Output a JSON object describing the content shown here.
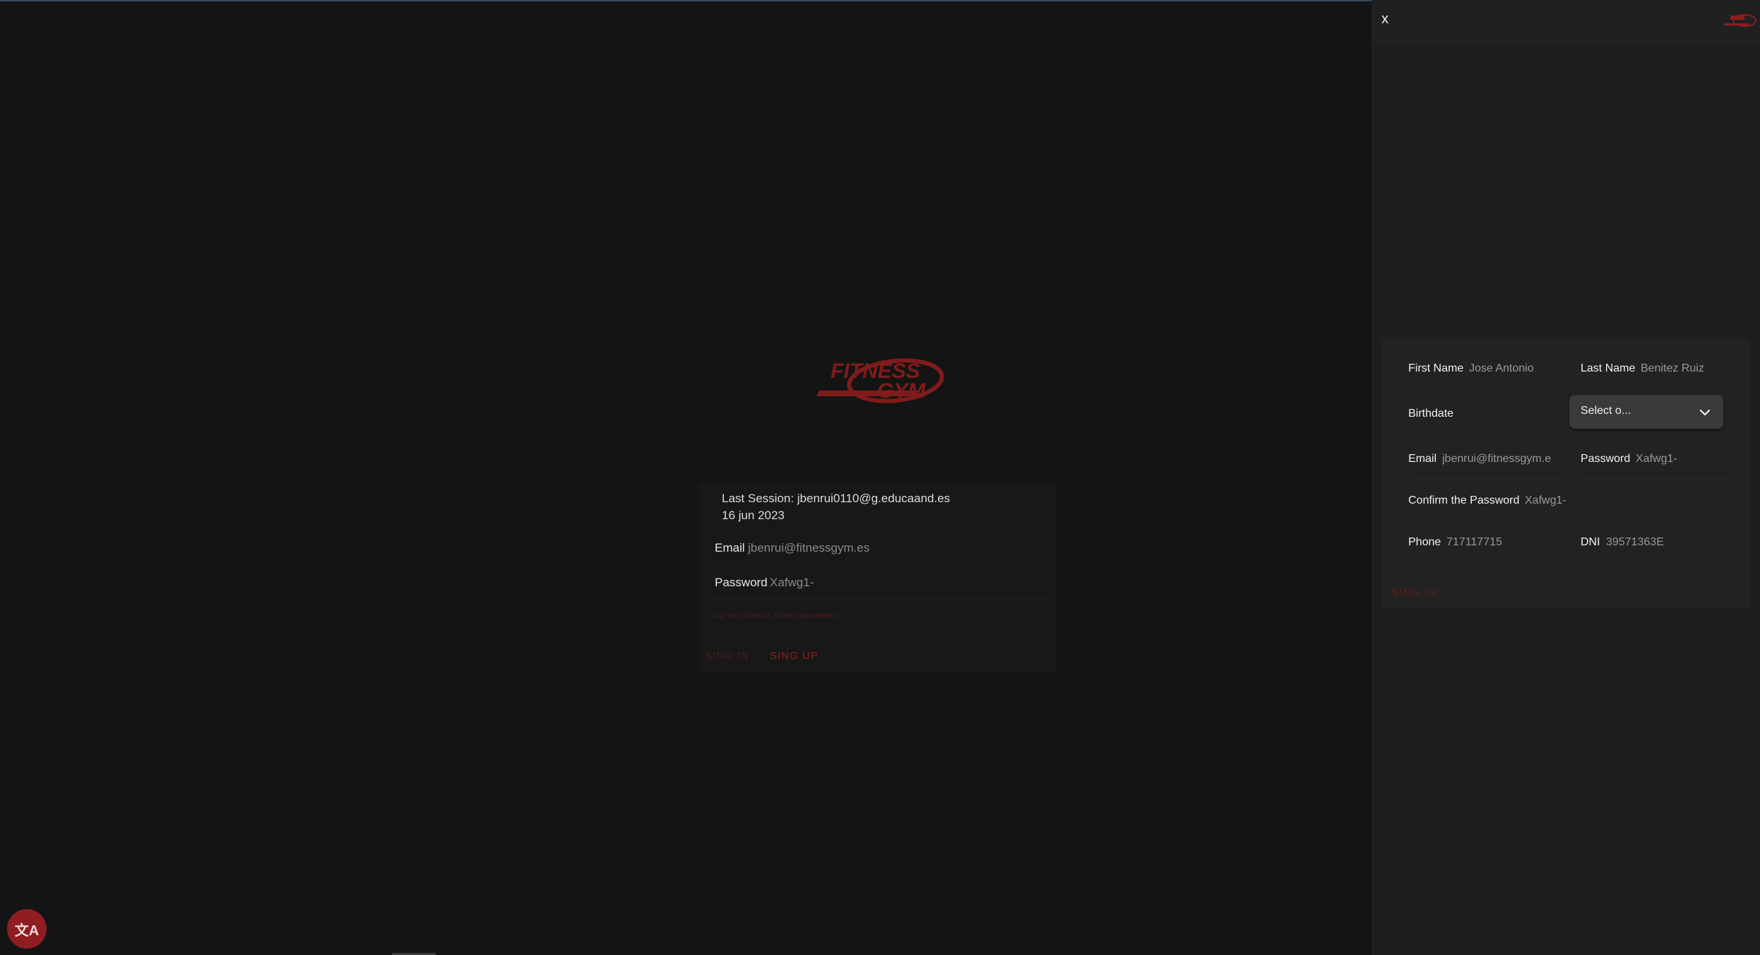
{
  "app": {
    "logo_text": "FITNESS GYM",
    "accent_color": "#8f1d22"
  },
  "login": {
    "last_session_label": "Last Session: jbenrui0110@g.educaand.es",
    "last_session_date": "16 jun 2023",
    "email_label": "Email",
    "email_value": "jbenrui@fitnessgym.es",
    "password_label": "Password",
    "password_value": "Xafwg1-",
    "forgot_label": "DO YOU FORGET YOUR PASSWORD?",
    "signin_label": "SING IN",
    "signup_label": "SING UP"
  },
  "translate_button": {
    "icon": "translate-icon",
    "glyph": "文A"
  },
  "drawer": {
    "close_label": "x",
    "fields": {
      "first_name_label": "First Name",
      "first_name_value": "Jose Antonio",
      "last_name_label": "Last Name",
      "last_name_value": "Benitez Ruiz",
      "birthdate_label": "Birthdate",
      "birthdate_select": "Select o...",
      "email_label": "Email",
      "email_value": "jbenrui@fitnessgym.e",
      "password_label": "Password",
      "password_value": "Xafwg1-",
      "confirm_label": "Confirm the Password",
      "confirm_value": "Xafwg1-",
      "phone_label": "Phone",
      "phone_value": "717117715",
      "dni_label": "DNI",
      "dni_value": "39571363E"
    },
    "signup_label": "SING UP"
  }
}
